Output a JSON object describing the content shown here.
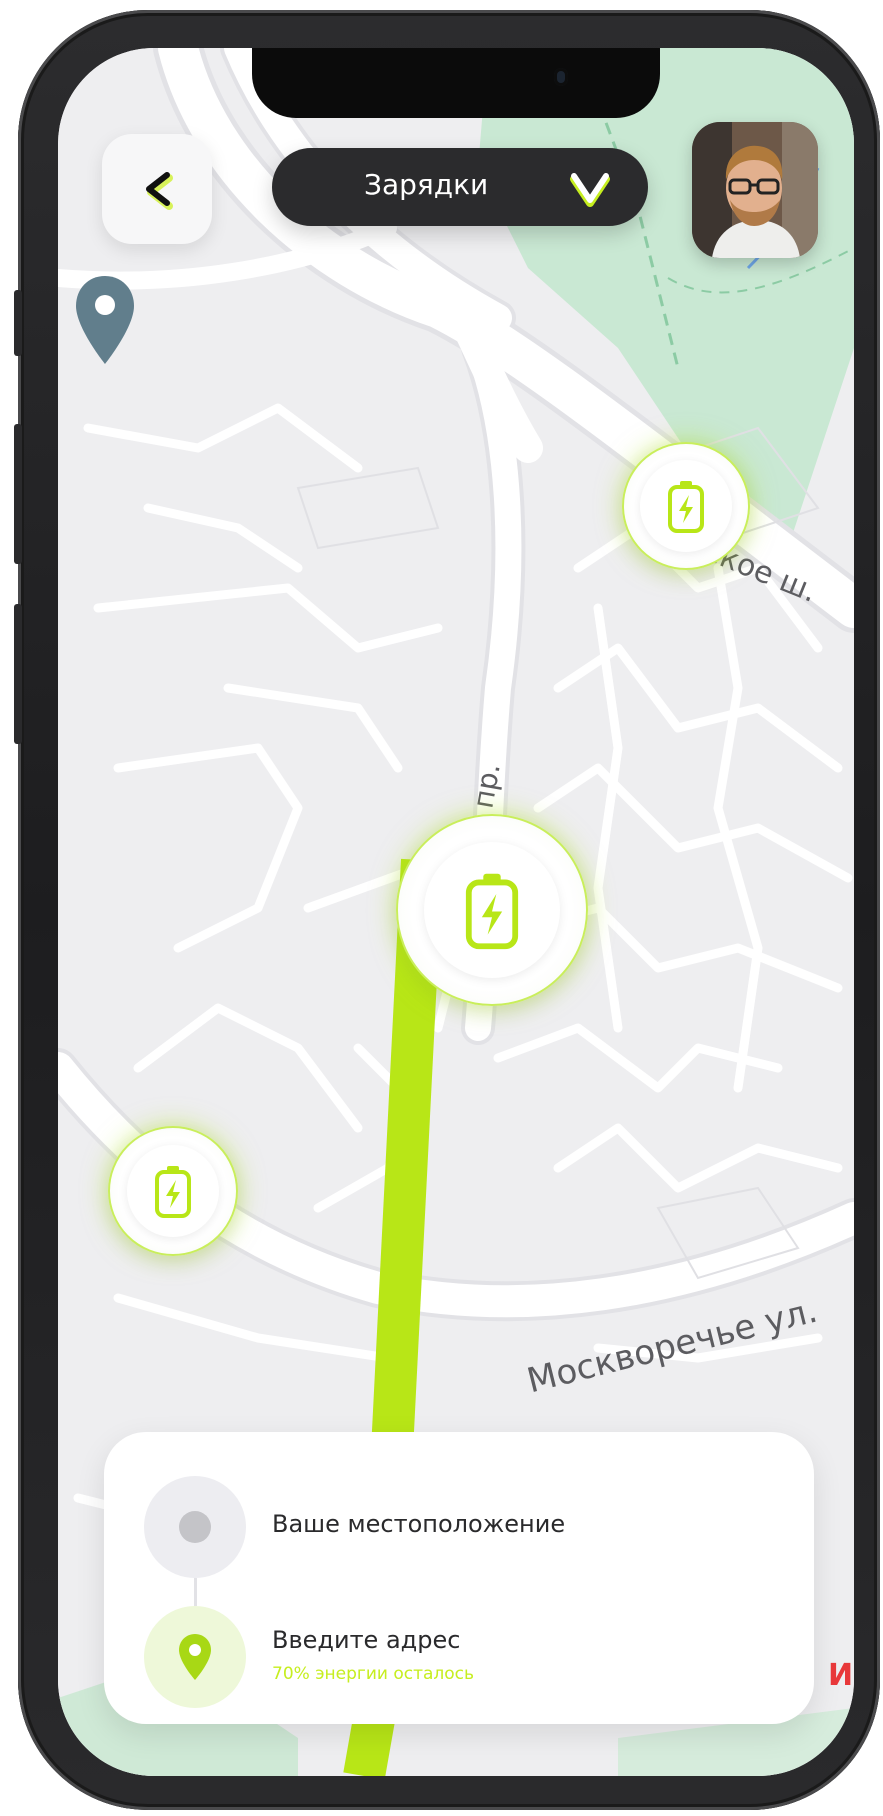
{
  "header": {
    "back_icon": "chevron-left-icon",
    "title": "Зарядки",
    "dropdown_icon": "chevron-down-icon",
    "avatar": "user-avatar-photo"
  },
  "map": {
    "street_labels": {
      "moskvorechye": "Москворечье ул.",
      "highway": "ское ш.",
      "prospect": "й пр."
    },
    "edge_label": "И",
    "station_icon": "battery-charging-icon",
    "marker_icon": "map-pin-icon",
    "colors": {
      "route": "#b8e617",
      "accent": "#c6ee1f",
      "park": "#c9e8d3",
      "road": "#ffffff",
      "land": "#eeeef0"
    }
  },
  "route_card": {
    "origin_label": "Ваше местоположение",
    "destination_label": "Введите адрес",
    "energy_status": "70% энергии осталось"
  }
}
